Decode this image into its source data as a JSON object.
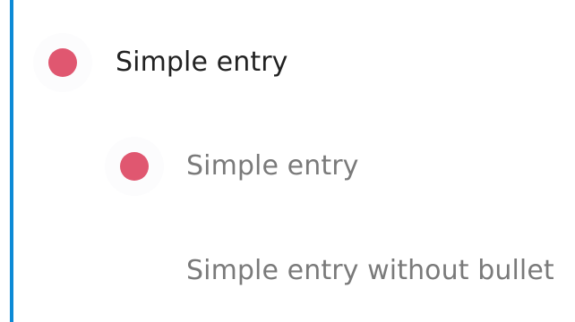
{
  "timeline": {
    "line_color": "#0c8ad6",
    "bullet_color": "#e05770",
    "entries": [
      {
        "label": "Simple entry",
        "level": 1,
        "bullet": true
      },
      {
        "label": "Simple entry",
        "level": 2,
        "bullet": true
      },
      {
        "label": "Simple entry without bullet",
        "level": 2,
        "bullet": false
      }
    ]
  }
}
